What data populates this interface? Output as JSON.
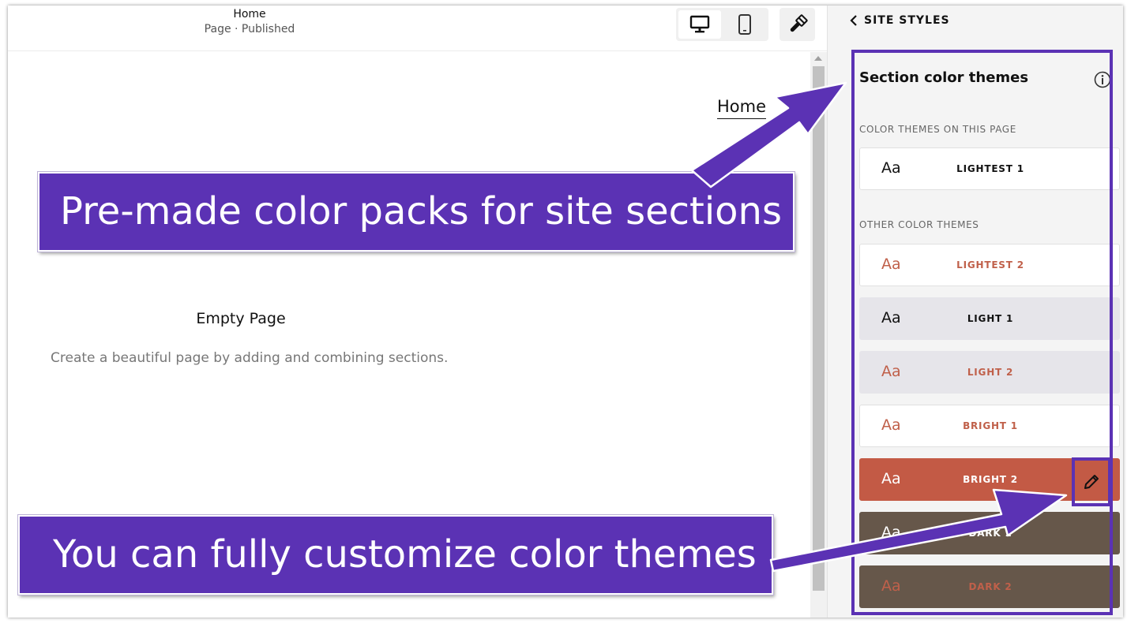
{
  "topbar": {
    "page_title": "Home",
    "page_status": "Page · Published"
  },
  "canvas": {
    "nav_link": "Home",
    "empty_title": "Empty Page",
    "empty_description": "Create a beautiful page by adding and combining sections."
  },
  "panel": {
    "back_label": "SITE STYLES",
    "section_title": "Section color themes",
    "on_page_label": "COLOR THEMES ON THIS PAGE",
    "other_label": "OTHER COLOR THEMES",
    "sample_text": "Aa",
    "themes_on_page": [
      {
        "name": "LIGHTEST 1",
        "bg": "#ffffff",
        "aa_color": "#111111",
        "name_color": "#111111"
      }
    ],
    "other_themes": [
      {
        "name": "LIGHTEST 2",
        "bg": "#ffffff",
        "aa_color": "#c0604a",
        "name_color": "#c0604a"
      },
      {
        "name": "LIGHT 1",
        "bg": "#e6e5ea",
        "aa_color": "#111111",
        "name_color": "#111111"
      },
      {
        "name": "LIGHT 2",
        "bg": "#e6e5ea",
        "aa_color": "#c0604a",
        "name_color": "#c0604a"
      },
      {
        "name": "BRIGHT 1",
        "bg": "#ffffff",
        "aa_color": "#c0604a",
        "name_color": "#c0604a"
      },
      {
        "name": "BRIGHT 2",
        "bg": "#c35a45",
        "aa_color": "#ffffff",
        "name_color": "#ffffff"
      },
      {
        "name": "DARK 1",
        "bg": "#66574a",
        "aa_color": "#ffffff",
        "name_color": "#ffffff"
      },
      {
        "name": "DARK 2",
        "bg": "#66574a",
        "aa_color": "#c0604a",
        "name_color": "#c0604a"
      }
    ]
  },
  "annotations": {
    "banner_top": "Pre-made color packs for site sections",
    "banner_bottom": "You can fully customize color themes",
    "accent_color": "#5b32b4"
  },
  "icons": {
    "desktop": "desktop-icon",
    "mobile": "mobile-icon",
    "style": "paintbrush-icon",
    "back": "chevron-left-icon",
    "info": "info-icon",
    "edit": "pencil-icon"
  }
}
